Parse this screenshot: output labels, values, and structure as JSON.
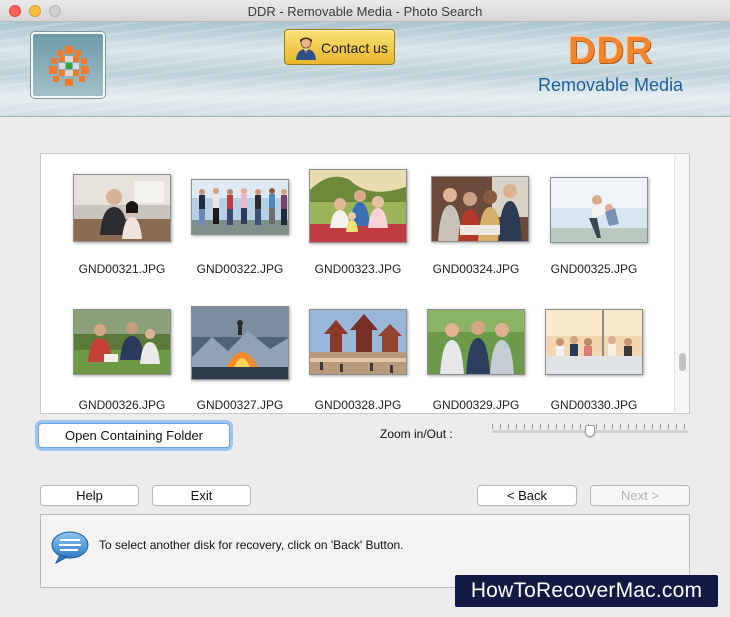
{
  "window": {
    "title": "DDR - Removable Media - Photo Search"
  },
  "header": {
    "contact_label": "Contact us",
    "brand_main": "DDR",
    "brand_sub": "Removable Media",
    "brand_color": "#f2852d",
    "accent_color": "#1f5f9d"
  },
  "gallery": {
    "items": [
      {
        "filename": "GND00321.JPG"
      },
      {
        "filename": "GND00322.JPG"
      },
      {
        "filename": "GND00323.JPG"
      },
      {
        "filename": "GND00324.JPG"
      },
      {
        "filename": "GND00325.JPG"
      },
      {
        "filename": "GND00326.JPG"
      },
      {
        "filename": "GND00327.JPG"
      },
      {
        "filename": "GND00328.JPG"
      },
      {
        "filename": "GND00329.JPG"
      },
      {
        "filename": "GND00330.JPG"
      }
    ]
  },
  "controls": {
    "open_folder_label": "Open Containing Folder",
    "zoom_label": "Zoom in/Out :",
    "zoom_level": 0.5
  },
  "nav": {
    "help_label": "Help",
    "exit_label": "Exit",
    "back_label": "< Back",
    "next_label": "Next >"
  },
  "status": {
    "message": "To select another disk for recovery, click on 'Back' Button."
  },
  "watermark": "HowToRecoverMac.com"
}
